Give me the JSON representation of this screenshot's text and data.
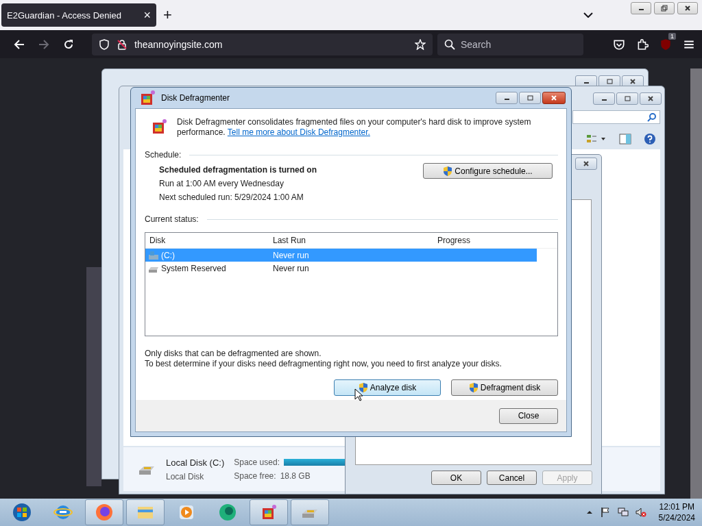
{
  "browser": {
    "tab": {
      "title": "E2Guardian - Access Denied",
      "close": "×"
    },
    "new_tab": "+",
    "url": "theannoyingsite.com",
    "search": {
      "placeholder": "Search"
    },
    "extension_badge": "1"
  },
  "explorer_window": {
    "details": {
      "name": "Local Disk (C:)",
      "type": "Local Disk",
      "space_used_label": "Space used:",
      "space_free_label": "Space free:",
      "space_free": "18.8 GB"
    }
  },
  "properties_dialog": {
    "buttons": [
      {
        "label": "OK",
        "disabled": false
      },
      {
        "label": "Cancel",
        "disabled": false
      },
      {
        "label": "Apply",
        "disabled": true
      }
    ]
  },
  "defrag": {
    "title": "Disk Defragmenter",
    "intro": "Disk Defragmenter consolidates fragmented files on your computer's hard disk to improve system performance.",
    "link": "Tell me more about Disk Defragmenter.",
    "schedule_label": "Schedule:",
    "schedule_status": "Scheduled defragmentation is turned on",
    "schedule_run": "Run at 1:00 AM every Wednesday",
    "next_run": "Next scheduled run: 5/29/2024 1:00 AM",
    "configure_button": "Configure schedule...",
    "status_label": "Current status:",
    "columns": [
      "Disk",
      "Last Run",
      "Progress"
    ],
    "disks": [
      {
        "disk": "(C:)",
        "last_run": "Never run",
        "kind": "system",
        "selected": true
      },
      {
        "disk": "System Reserved",
        "last_run": "Never run",
        "kind": "drive",
        "selected": false
      }
    ],
    "notes": [
      "Only disks that can be defragmented are shown.",
      "To best determine if your disks need defragmenting right now, you need to first analyze your disks."
    ],
    "buttons": [
      {
        "label": "Analyze disk",
        "hovered": true
      },
      {
        "label": "Defragment disk",
        "hovered": false
      }
    ],
    "close_button": "Close"
  },
  "taskbar": {
    "apps": [
      {
        "kind": "start",
        "open": false
      },
      {
        "kind": "ie",
        "open": false
      },
      {
        "kind": "firefox",
        "open": true
      },
      {
        "kind": "explorer",
        "open": true
      },
      {
        "kind": "media",
        "open": false
      },
      {
        "kind": "edge",
        "open": false
      },
      {
        "kind": "defrag",
        "open": true
      },
      {
        "kind": "drive",
        "open": true
      }
    ],
    "clock": {
      "time": "12:01 PM",
      "date": "5/24/2024"
    }
  }
}
